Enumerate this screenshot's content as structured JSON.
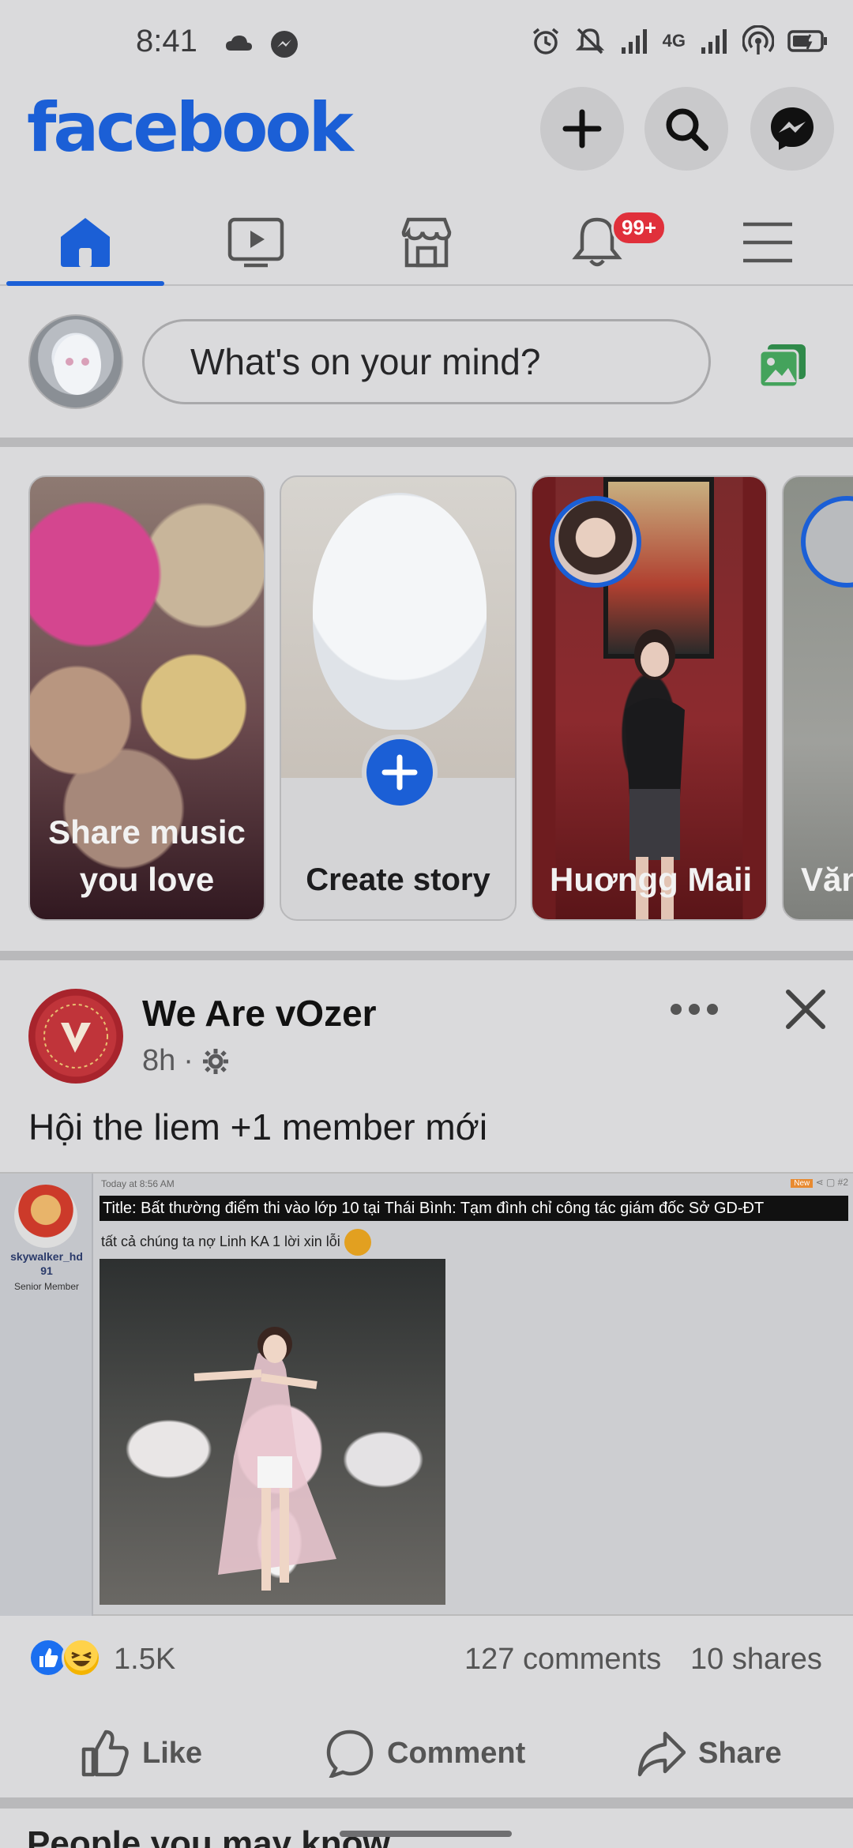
{
  "status_bar": {
    "time": "8:41",
    "network": "4G"
  },
  "header": {
    "logo": "facebook",
    "buttons": [
      "plus-icon",
      "search-icon",
      "messenger-icon"
    ],
    "brand_color": "#1b5fd6"
  },
  "tabs": {
    "items": [
      "home",
      "watch",
      "marketplace",
      "notifications",
      "menu"
    ],
    "active": "home",
    "notifications_badge": "99+"
  },
  "composer": {
    "placeholder": "What's on your mind?"
  },
  "stories": [
    {
      "label": "Share music you love"
    },
    {
      "label": "Create story"
    },
    {
      "label": "Huơngg Maii"
    },
    {
      "label": "Văn"
    }
  ],
  "post": {
    "page_name": "We Are vOzer",
    "time": "8h",
    "separator": "·",
    "text": "Hội the liem +1 member mới",
    "embedded": {
      "timestamp": "Today at 8:56 AM",
      "new_tag": "New",
      "post_number": "#2",
      "title": "Title: Bất thường điểm thi vào lớp 10 tại Thái Bình: Tạm đình chỉ công tác giám đốc Sở GD-ĐT",
      "subline": "tất cả chúng ta nợ Linh KA 1 lời xin lỗi",
      "username": "skywalker_hd 91",
      "rank": "Senior Member"
    },
    "reaction_count": "1.5K",
    "comments": "127 comments",
    "shares": "10 shares",
    "actions": {
      "like": "Like",
      "comment": "Comment",
      "share": "Share"
    }
  },
  "next_section_peek": "People you may know"
}
